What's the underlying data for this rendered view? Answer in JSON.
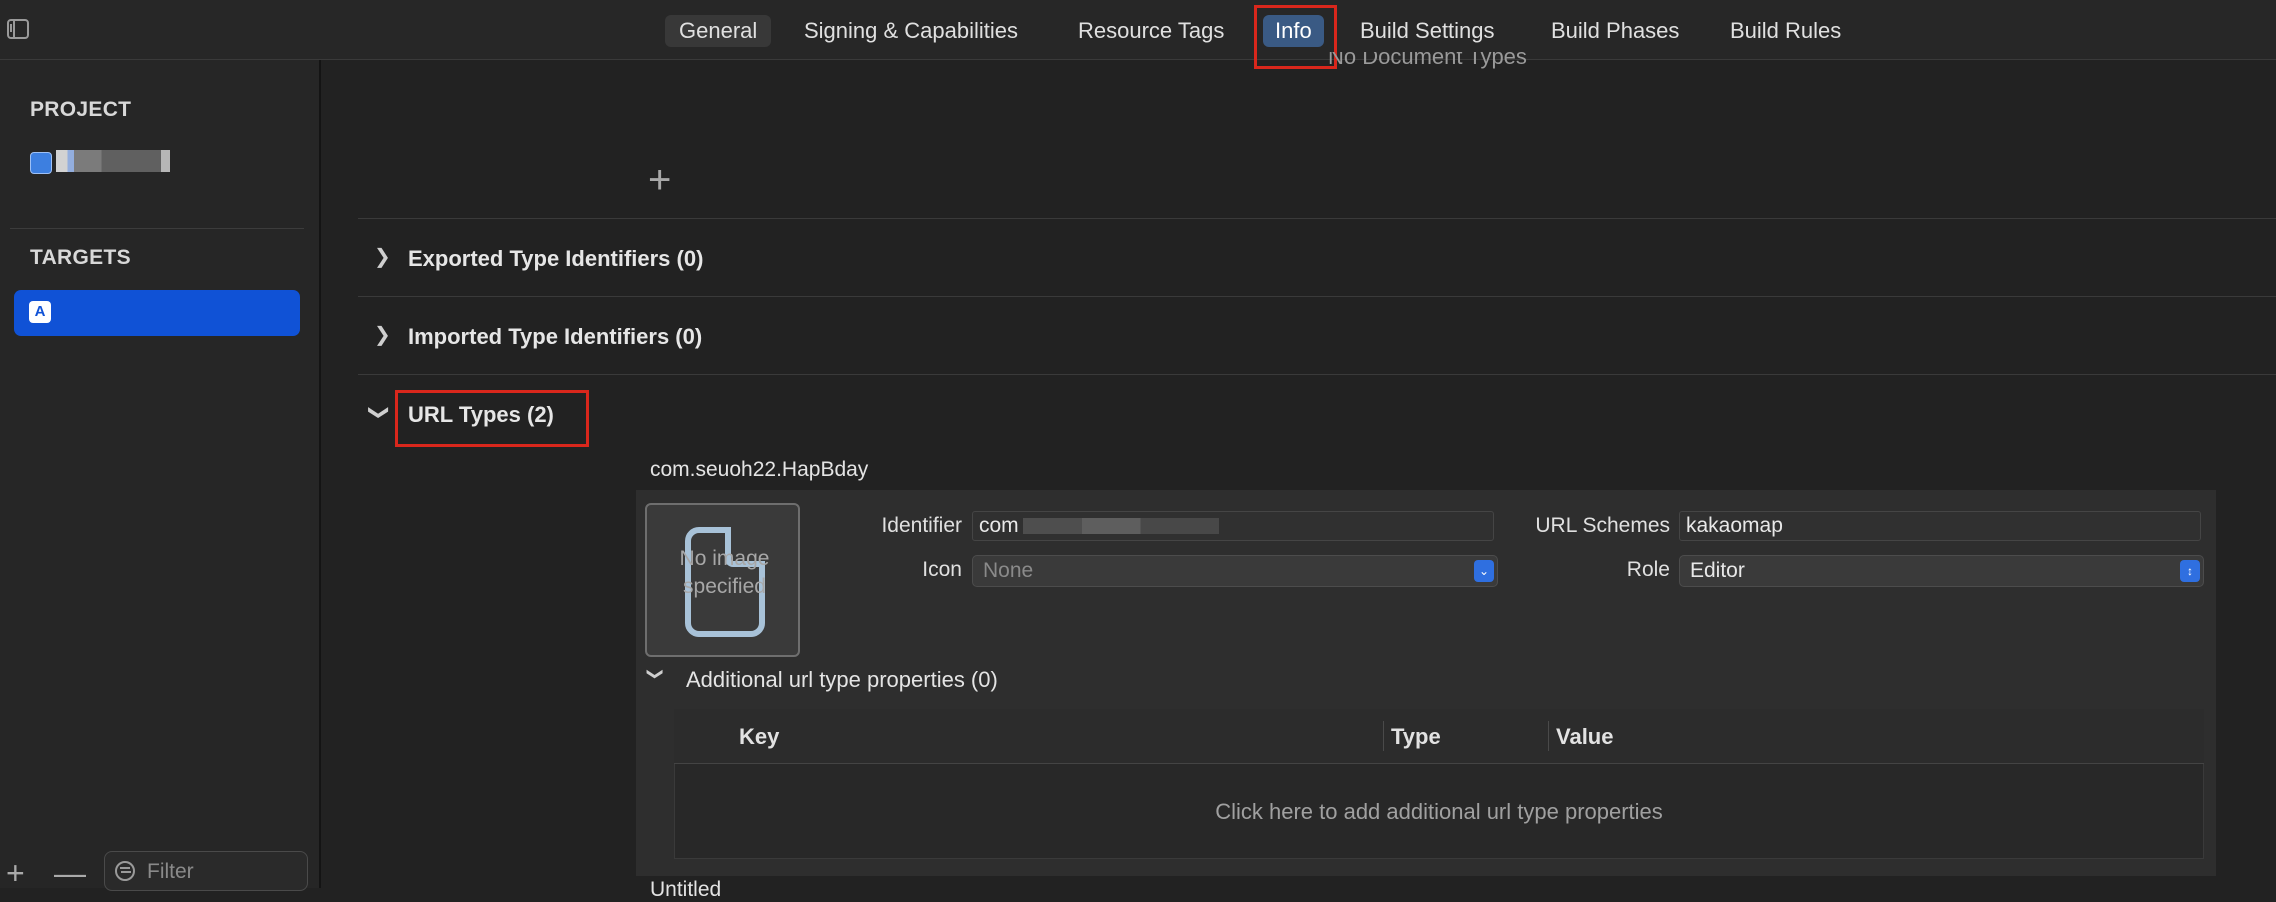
{
  "tabs": [
    {
      "label": "General"
    },
    {
      "label": "Signing & Capabilities"
    },
    {
      "label": "Resource Tags"
    },
    {
      "label": "Info"
    },
    {
      "label": "Build Settings"
    },
    {
      "label": "Build Phases"
    },
    {
      "label": "Build Rules"
    }
  ],
  "sidebar": {
    "project_heading": "PROJECT",
    "targets_heading": "TARGETS",
    "filter_placeholder": "Filter",
    "add_symbol": "+",
    "remove_symbol": "—"
  },
  "main": {
    "no_document_types": "No Document Types",
    "add_symbol": "+",
    "sections": [
      {
        "title": "Exported Type Identifiers (0)"
      },
      {
        "title": "Imported Type Identifiers (0)"
      },
      {
        "title": "URL Types (2)"
      }
    ],
    "url_type": {
      "name": "com.seuoh22.HapBday",
      "image_placeholder": "No image specified",
      "identifier_label": "Identifier",
      "identifier_value": "com",
      "icon_label": "Icon",
      "icon_value": "None",
      "url_schemes_label": "URL Schemes",
      "url_schemes_value": "kakaomap",
      "role_label": "Role",
      "role_value": "Editor",
      "additional_title": "Additional url type properties (0)",
      "table_headers": [
        "Key",
        "Type",
        "Value"
      ],
      "empty_table_text": "Click here to add additional url type properties"
    },
    "next_item_partial": "Untitled"
  },
  "colors": {
    "selection_blue": "#1052d6",
    "info_tab_active": "#3a5a84",
    "highlight_red": "#d9271c"
  }
}
